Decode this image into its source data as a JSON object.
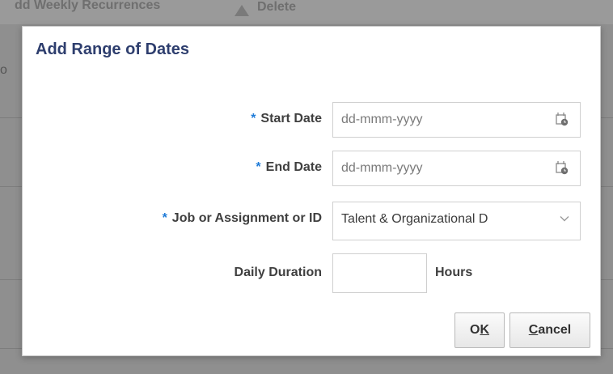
{
  "background": {
    "toolbar_action": "dd Weekly Recurrences",
    "delete_label": "Delete",
    "left_fragment": "o"
  },
  "dialog": {
    "title": "Add Range of Dates",
    "required_marker": "*",
    "start_date": {
      "label": "Start Date",
      "placeholder": "dd-mmm-yyyy"
    },
    "end_date": {
      "label": "End Date",
      "placeholder": "dd-mmm-yyyy"
    },
    "assignment": {
      "label": "Job or Assignment or ID",
      "value": "Talent & Organizational D"
    },
    "duration": {
      "label": "Daily Duration",
      "value": "",
      "unit": "Hours"
    },
    "buttons": {
      "ok": {
        "prefix": "O",
        "mnemonic": "K",
        "suffix": ""
      },
      "cancel": {
        "prefix": "",
        "mnemonic": "C",
        "suffix": "ancel"
      }
    }
  },
  "icons": {
    "calendar": "calendar-icon",
    "chevron": "chevron-down-icon"
  },
  "colors": {
    "title": "#2e3e6e",
    "required": "#1e7bd8",
    "overlay": "#8f8f8f"
  }
}
